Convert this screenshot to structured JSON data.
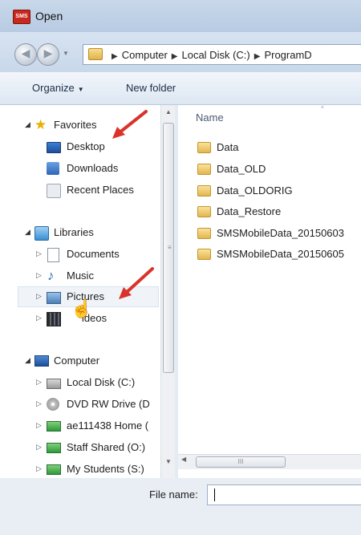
{
  "window": {
    "title": "Open",
    "app_icon_text": "SMS"
  },
  "address": {
    "crumbs": [
      "Computer",
      "Local Disk (C:)",
      "ProgramD"
    ]
  },
  "toolbar": {
    "organize": "Organize",
    "new_folder": "New folder"
  },
  "nav": {
    "favorites": {
      "label": "Favorites",
      "items": [
        "Desktop",
        "Downloads",
        "Recent Places"
      ]
    },
    "libraries": {
      "label": "Libraries",
      "items": [
        "Documents",
        "Music",
        "Pictures",
        "ideos"
      ]
    },
    "computer": {
      "label": "Computer",
      "items": [
        "Local Disk (C:)",
        "DVD RW Drive (D",
        "ae111438 Home (",
        "Staff Shared (O:)",
        "My Students (S:)"
      ]
    }
  },
  "content": {
    "column_name": "Name",
    "files": [
      "Data",
      "Data_OLD",
      "Data_OLDORIG",
      "Data_Restore",
      "SMSMobileData_20150603",
      "SMSMobileData_20150605"
    ]
  },
  "bottom": {
    "file_name_label": "File name:",
    "file_name_value": ""
  },
  "annotation_color": "#d9342b"
}
